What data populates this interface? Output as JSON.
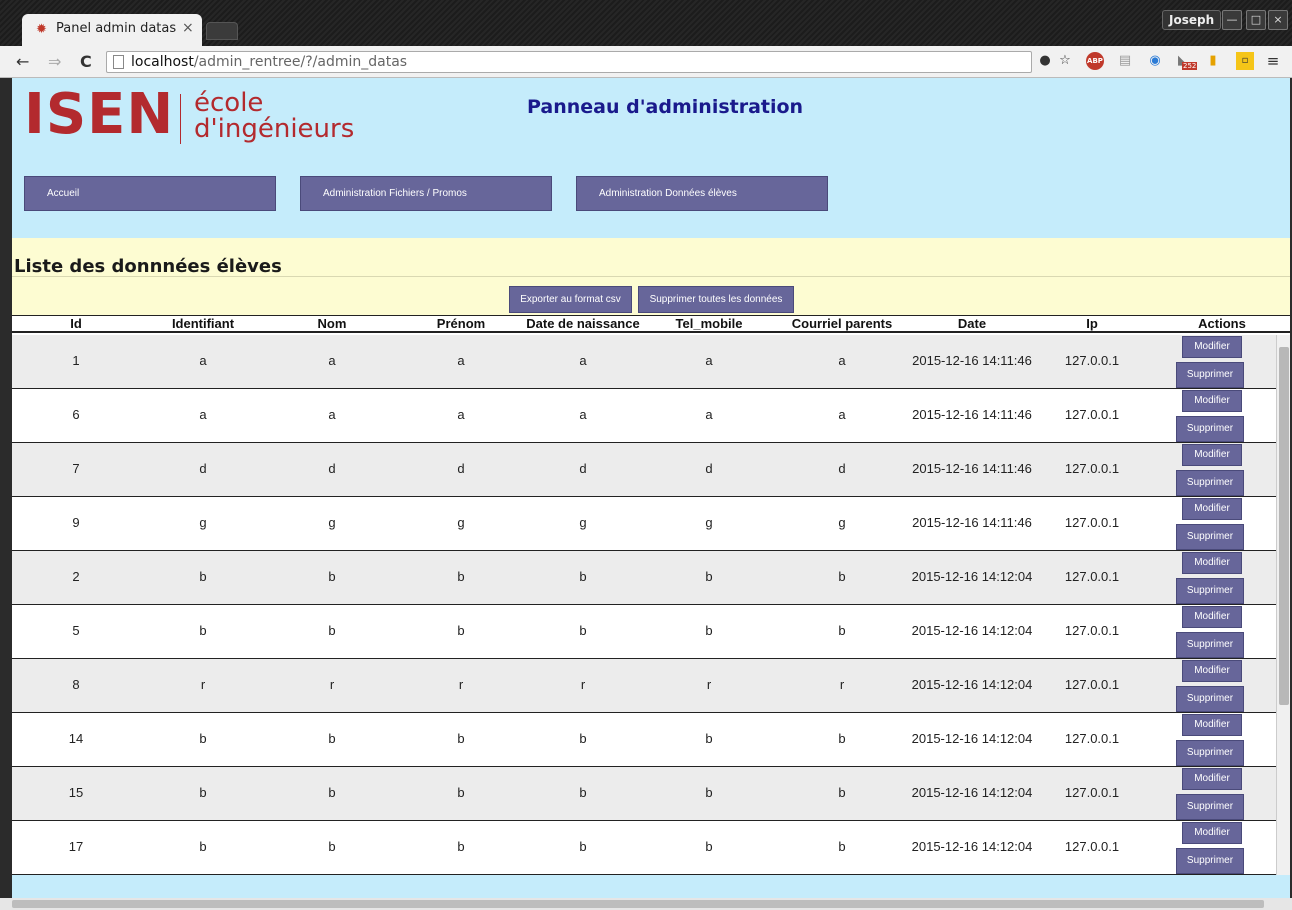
{
  "browser": {
    "tab_title": "Panel admin datas",
    "tab_close": "×",
    "user": "Joseph",
    "url_host": "localhost",
    "url_path": "/admin_rentree/?/admin_datas",
    "back": "←",
    "forward": "⇒",
    "reload": "C",
    "adblock": "ABP",
    "rss_count": "252",
    "win_min": "—",
    "win_max": "□",
    "win_close": "×"
  },
  "logo": {
    "isen": "ISEN",
    "line1": "école",
    "line2": "d'ingénieurs"
  },
  "header": {
    "title": "Panneau d'administration"
  },
  "nav": [
    {
      "label": "Accueil"
    },
    {
      "label": "Administration Fichiers / Promos"
    },
    {
      "label": "Administration Données élèves"
    }
  ],
  "section": {
    "title": "Liste des donnnées élèves",
    "export_label": "Exporter au format csv",
    "delete_all_label": "Supprimer toutes les données"
  },
  "table": {
    "columns": [
      "Id",
      "Identifiant",
      "Nom",
      "Prénom",
      "Date de naissance",
      "Tel_mobile",
      "Courriel parents",
      "Date",
      "Ip",
      "Actions"
    ],
    "modify_label": "Modifier",
    "delete_label": "Supprimer",
    "rows": [
      [
        "1",
        "a",
        "a",
        "a",
        "a",
        "a",
        "a",
        "2015-12-16 14:11:46",
        "127.0.0.1"
      ],
      [
        "6",
        "a",
        "a",
        "a",
        "a",
        "a",
        "a",
        "2015-12-16 14:11:46",
        "127.0.0.1"
      ],
      [
        "7",
        "d",
        "d",
        "d",
        "d",
        "d",
        "d",
        "2015-12-16 14:11:46",
        "127.0.0.1"
      ],
      [
        "9",
        "g",
        "g",
        "g",
        "g",
        "g",
        "g",
        "2015-12-16 14:11:46",
        "127.0.0.1"
      ],
      [
        "2",
        "b",
        "b",
        "b",
        "b",
        "b",
        "b",
        "2015-12-16 14:12:04",
        "127.0.0.1"
      ],
      [
        "5",
        "b",
        "b",
        "b",
        "b",
        "b",
        "b",
        "2015-12-16 14:12:04",
        "127.0.0.1"
      ],
      [
        "8",
        "r",
        "r",
        "r",
        "r",
        "r",
        "r",
        "2015-12-16 14:12:04",
        "127.0.0.1"
      ],
      [
        "14",
        "b",
        "b",
        "b",
        "b",
        "b",
        "b",
        "2015-12-16 14:12:04",
        "127.0.0.1"
      ],
      [
        "15",
        "b",
        "b",
        "b",
        "b",
        "b",
        "b",
        "2015-12-16 14:12:04",
        "127.0.0.1"
      ],
      [
        "17",
        "b",
        "b",
        "b",
        "b",
        "b",
        "b",
        "2015-12-16 14:12:04",
        "127.0.0.1"
      ]
    ]
  },
  "colors": {
    "header_bg": "#c5ecfb",
    "section_bg": "#fdfcd2",
    "button_bg": "#67669a",
    "logo_red": "#b32a2e",
    "title_blue": "#1a1a8c"
  }
}
